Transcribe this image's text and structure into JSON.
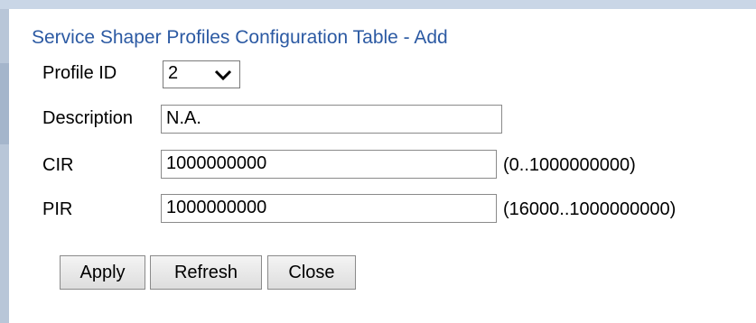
{
  "title": "Service Shaper Profiles Configuration Table - Add",
  "profile_id": {
    "label": "Profile ID",
    "selected": "2"
  },
  "description": {
    "label": "Description",
    "value": "N.A."
  },
  "cir": {
    "label": "CIR",
    "value": "1000000000",
    "range": "(0..1000000000)"
  },
  "pir": {
    "label": "PIR",
    "value": "1000000000",
    "range": "(16000..1000000000)"
  },
  "buttons": {
    "apply": "Apply",
    "refresh": "Refresh",
    "close": "Close"
  },
  "icons": {
    "dropdown": "chevron-down-icon"
  }
}
